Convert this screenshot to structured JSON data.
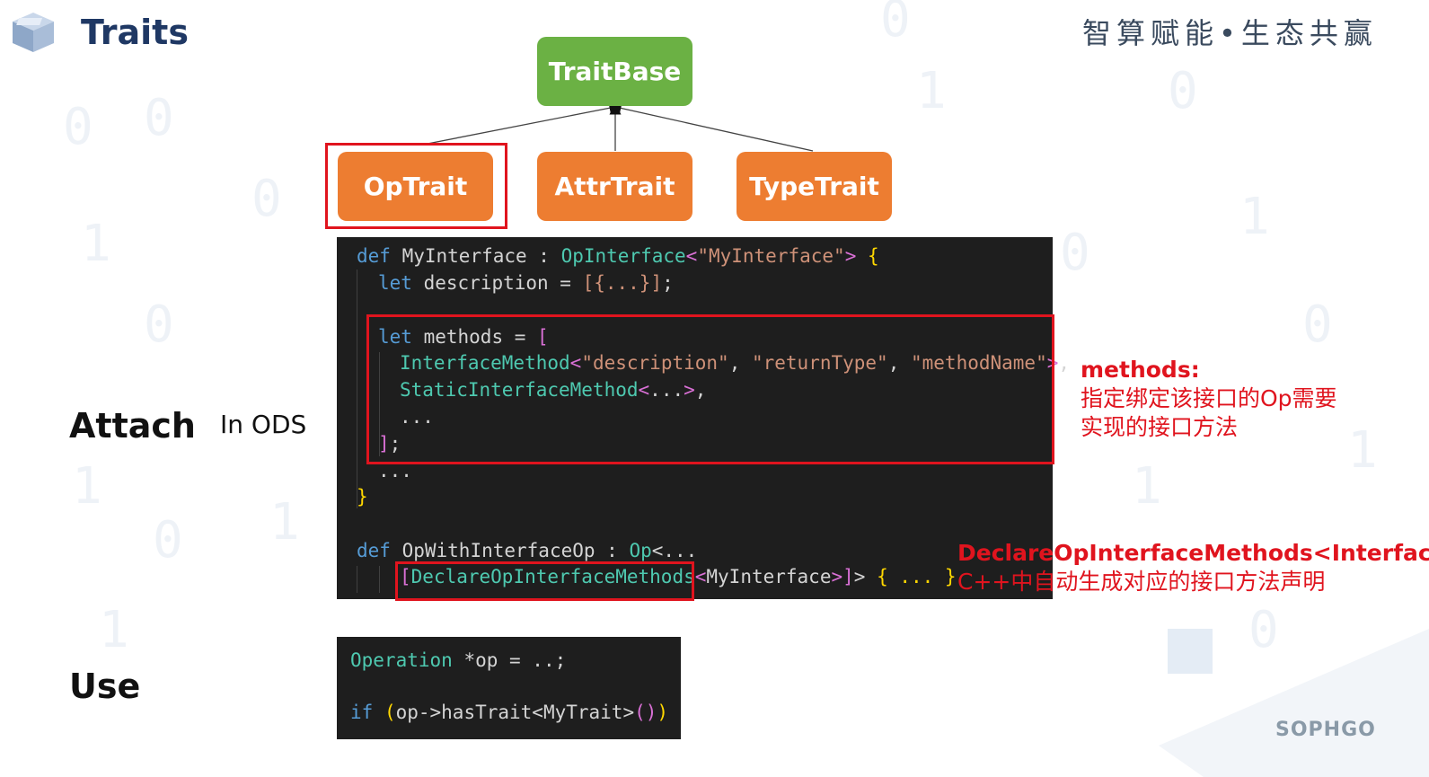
{
  "header": {
    "title": "Traits",
    "slogan": "智算赋能•生态共赢"
  },
  "diagram": {
    "root": "TraitBase",
    "children": [
      "OpTrait",
      "AttrTrait",
      "TypeTrait"
    ],
    "highlighted": "OpTrait"
  },
  "labels": {
    "attach": "Attach",
    "in_ods": "In ODS",
    "use": "Use"
  },
  "code_ods": {
    "l1_def": "def",
    "l1_name": " MyInterface : ",
    "l1_base": "OpInterface",
    "l1_lt": "<",
    "l1_str": "\"MyInterface\"",
    "l1_gt": "> ",
    "l1_brace": "{",
    "l2_let": "let",
    "l2_rest": " description = ",
    "l2_val": "[{...}]",
    "l2_semi": ";",
    "l3_let": "let",
    "l3_rest": " methods = ",
    "l3_br": "[",
    "l4_name": "InterfaceMethod",
    "l4_lt": "<",
    "l4_s1": "\"description\"",
    "l4_c1": ", ",
    "l4_s2": "\"returnType\"",
    "l4_c2": ", ",
    "l4_s3": "\"methodName\"",
    "l4_gt": ">",
    "l4_end": ",",
    "l5_name": "StaticInterfaceMethod",
    "l5_lt": "<",
    "l5_dots": "...",
    "l5_gt": ">",
    "l5_end": ",",
    "l6_dots": "...",
    "l7_br": "]",
    "l7_semi": ";",
    "l8_dots": "...",
    "l9_brace": "}",
    "l10_def": "def",
    "l10_name": " OpWithInterfaceOp : ",
    "l10_op": "Op",
    "l10_rest": "<...",
    "l11_br": "[",
    "l11_decl": "DeclareOpInterfaceMethods",
    "l11_lt": "<",
    "l11_arg": "MyInterface",
    "l11_gt": ">",
    "l11_br2": "]",
    "l11_gt2": "> ",
    "l11_brace": "{ ... }"
  },
  "code_use": {
    "l1_type": "Operation",
    "l1_rest": " *op = ..;",
    "l2_if": "if",
    "l2_p": " (",
    "l2_call": "op->hasTrait<MyTrait>",
    "l2_paren": "()",
    "l2_close": ")"
  },
  "notes": {
    "methods_title": "methods:",
    "methods_line1": "指定绑定该接口的Op需要",
    "methods_line2": "实现的接口方法",
    "declare_title": "DeclareOpInterfaceMethods<Interface>:",
    "declare_line": "C++中自动生成对应的接口方法声明"
  },
  "brand": "SOPHGO",
  "colors": {
    "title": "#1f3864",
    "green": "#6bb144",
    "orange": "#ed7d31",
    "highlight": "#e0141e",
    "code_bg": "#1e1e1e"
  }
}
